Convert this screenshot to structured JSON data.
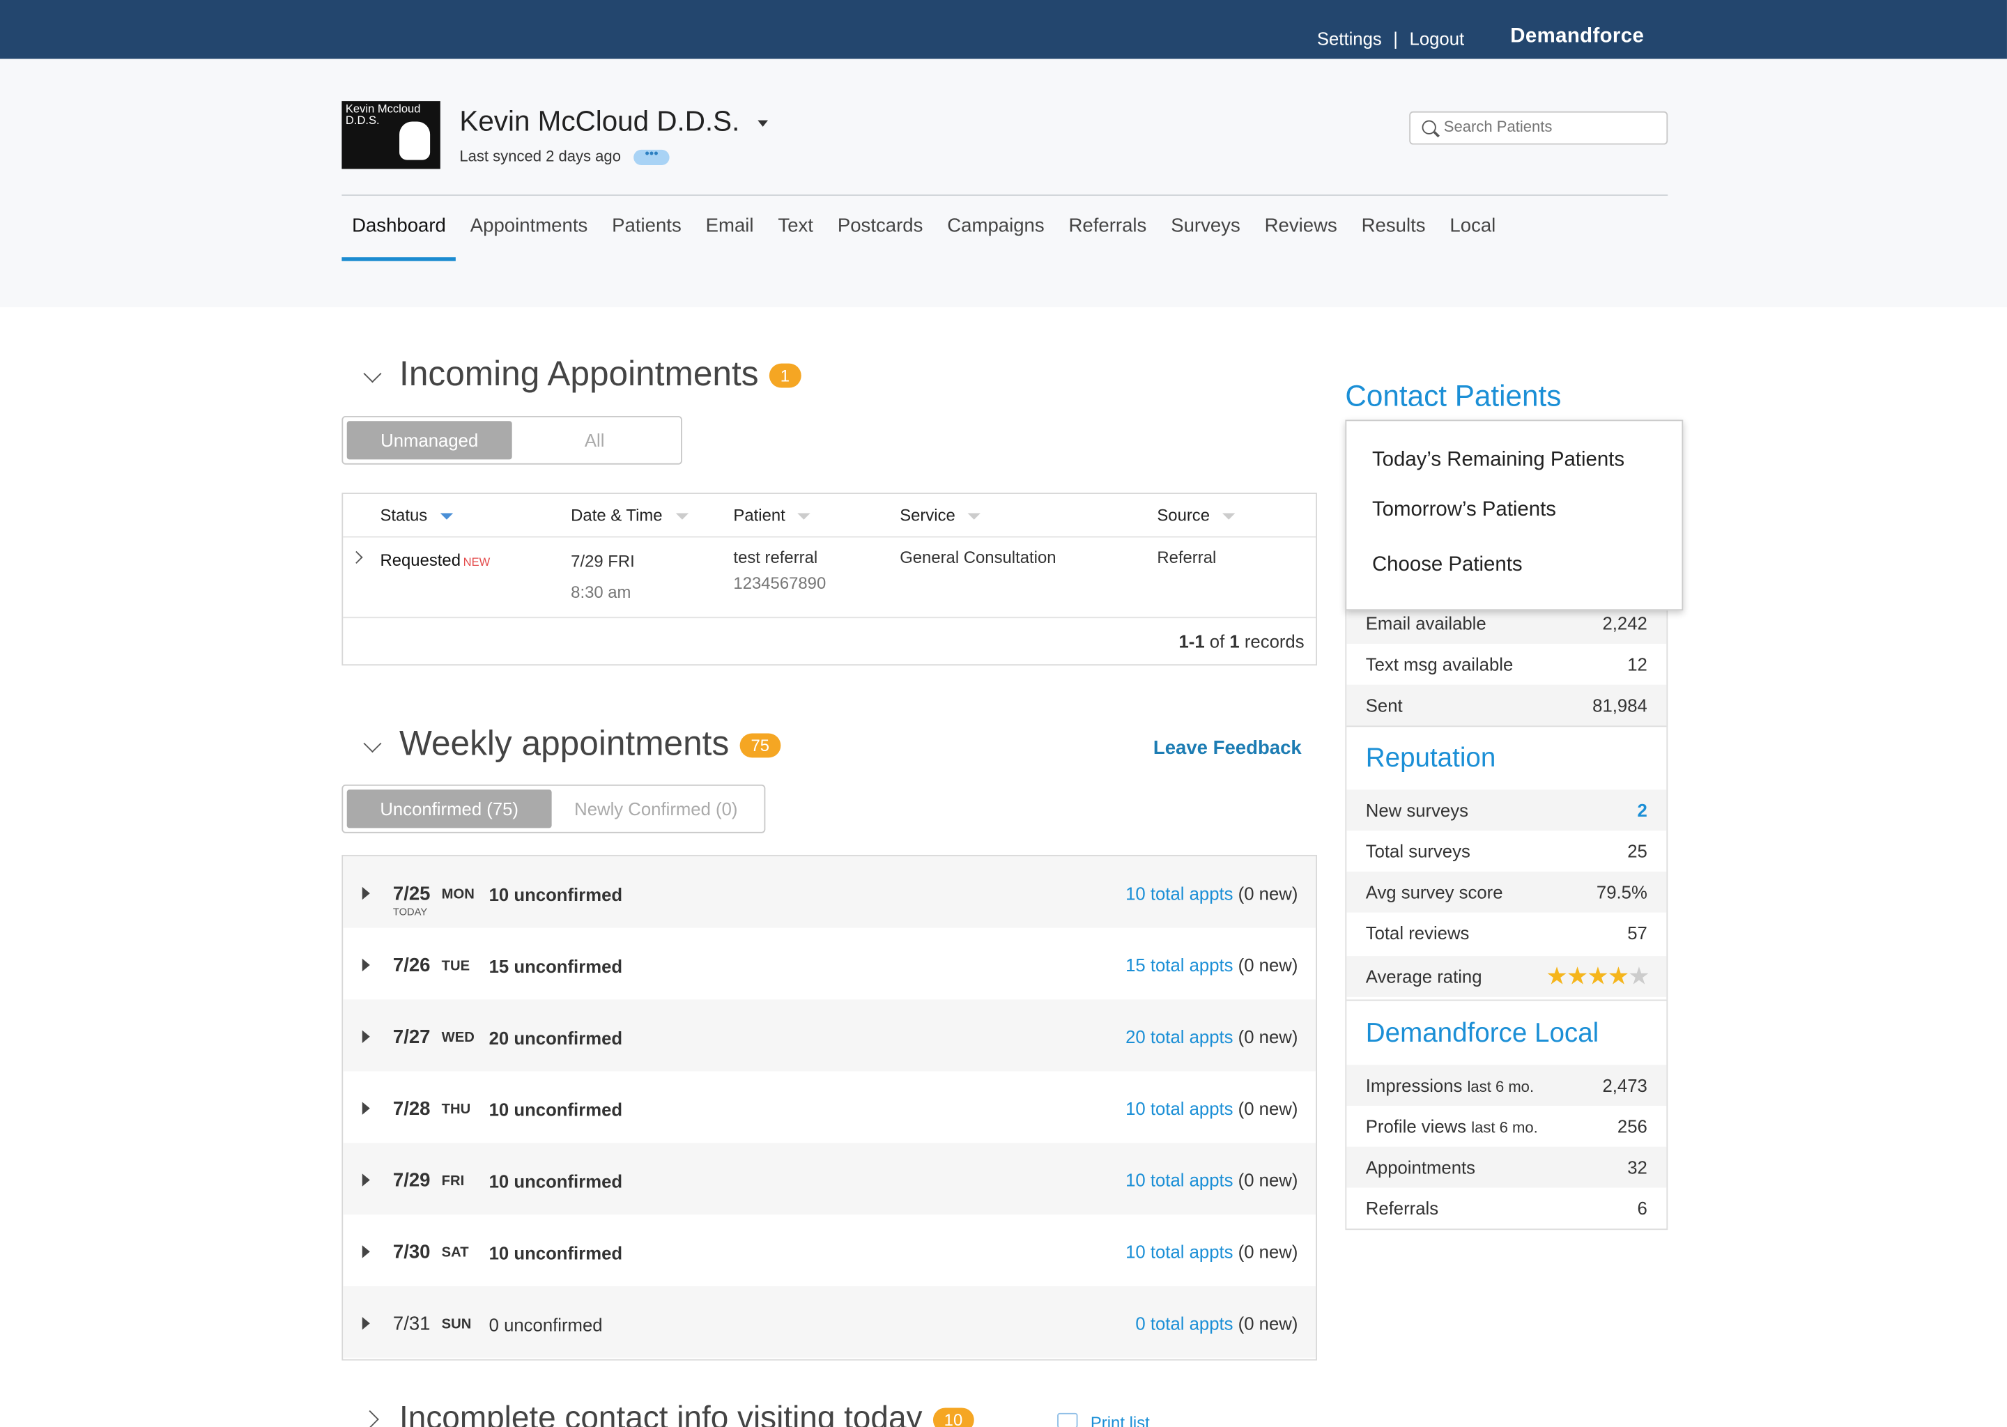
{
  "topbar": {
    "settings": "Settings",
    "sep": "|",
    "logout": "Logout",
    "brand": "Demandforce"
  },
  "header": {
    "logo_text": "Kevin Mccloud D.D.S.",
    "practice_name": "Kevin McCloud D.D.S.",
    "synced": "Last synced 2 days ago",
    "sync_dots": "•••",
    "search_placeholder": "Search Patients"
  },
  "nav": [
    "Dashboard",
    "Appointments",
    "Patients",
    "Email",
    "Text",
    "Postcards",
    "Campaigns",
    "Referrals",
    "Surveys",
    "Reviews",
    "Results",
    "Local"
  ],
  "incoming": {
    "title": "Incoming Appointments",
    "badge": "1",
    "toggle": [
      "Unmanaged",
      "All"
    ],
    "columns": [
      "Status",
      "Date & Time",
      "Patient",
      "Service",
      "Source"
    ],
    "row": {
      "status": "Requested",
      "new_tag": "NEW",
      "date": "7/29 FRI",
      "time": "8:30 am",
      "patient": "test referral",
      "phone": "1234567890",
      "service": "General Consultation",
      "source": "Referral"
    },
    "records": {
      "range": "1-1",
      "of": " of ",
      "total": "1",
      "suffix": " records"
    }
  },
  "weekly": {
    "title": "Weekly appointments",
    "badge": "75",
    "feedback": "Leave Feedback",
    "toggle": [
      "Unconfirmed (75)",
      "Newly Confirmed (0)"
    ],
    "rows": [
      {
        "date": "7/25",
        "dow": "MON",
        "today": "TODAY",
        "unconfirmed": "10 unconfirmed",
        "total": "10 total appts",
        "new": "(0 new)"
      },
      {
        "date": "7/26",
        "dow": "TUE",
        "unconfirmed": "15 unconfirmed",
        "total": "15 total appts",
        "new": "(0 new)"
      },
      {
        "date": "7/27",
        "dow": "WED",
        "unconfirmed": "20 unconfirmed",
        "total": "20 total appts",
        "new": "(0 new)"
      },
      {
        "date": "7/28",
        "dow": "THU",
        "unconfirmed": "10 unconfirmed",
        "total": "10 total appts",
        "new": "(0 new)"
      },
      {
        "date": "7/29",
        "dow": "FRI",
        "unconfirmed": "10 unconfirmed",
        "total": "10 total appts",
        "new": "(0 new)"
      },
      {
        "date": "7/30",
        "dow": "SAT",
        "unconfirmed": "10 unconfirmed",
        "total": "10 total appts",
        "new": "(0 new)"
      },
      {
        "date": "7/31",
        "dow": "SUN",
        "unconfirmed": "0 unconfirmed",
        "total": "0 total appts",
        "new": "(0 new)"
      }
    ]
  },
  "incomplete": {
    "title": "Incomplete contact info visiting today",
    "badge": "10",
    "print": "Print list"
  },
  "contact": {
    "title": "Contact Patients",
    "menu": [
      "Today’s Remaining Patients",
      "Tomorrow’s Patients",
      "Choose Patients"
    ],
    "stats": [
      {
        "label": "Email available",
        "value": "2,242"
      },
      {
        "label": "Text msg available",
        "value": "12"
      },
      {
        "label": "Sent",
        "value": "81,984"
      }
    ]
  },
  "reputation": {
    "title": "Reputation",
    "stats": [
      {
        "label": "New surveys",
        "value": "2"
      },
      {
        "label": "Total surveys",
        "value": "25"
      },
      {
        "label": "Avg survey score",
        "value": "79.5%"
      },
      {
        "label": "Total reviews",
        "value": "57"
      },
      {
        "label": "Average rating",
        "value": ""
      }
    ],
    "rating": 4.5
  },
  "local": {
    "title": "Demandforce Local",
    "stats": [
      {
        "label": "Impressions",
        "sub": "last 6 mo.",
        "value": "2,473"
      },
      {
        "label": "Profile views",
        "sub": "last 6 mo.",
        "value": "256"
      },
      {
        "label": "Appointments",
        "sub": "",
        "value": "32"
      },
      {
        "label": "Referrals",
        "sub": "",
        "value": "6"
      }
    ]
  },
  "colors": {
    "topbar": "#23466e",
    "accent": "#1b8fd6",
    "badge": "#f5a623",
    "new_tag": "#e34b4b"
  }
}
